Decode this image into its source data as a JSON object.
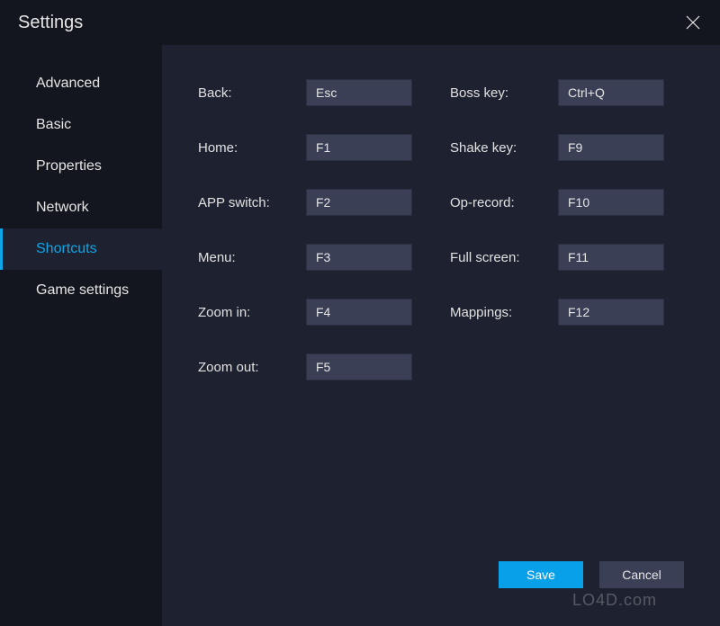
{
  "titlebar": {
    "title": "Settings"
  },
  "sidebar": {
    "items": [
      {
        "label": "Advanced",
        "active": false
      },
      {
        "label": "Basic",
        "active": false
      },
      {
        "label": "Properties",
        "active": false
      },
      {
        "label": "Network",
        "active": false
      },
      {
        "label": "Shortcuts",
        "active": true
      },
      {
        "label": "Game settings",
        "active": false
      }
    ]
  },
  "shortcuts": {
    "left": [
      {
        "label": "Back:",
        "value": "Esc"
      },
      {
        "label": "Home:",
        "value": "F1"
      },
      {
        "label": "APP switch:",
        "value": "F2"
      },
      {
        "label": "Menu:",
        "value": "F3"
      },
      {
        "label": "Zoom in:",
        "value": "F4"
      },
      {
        "label": "Zoom out:",
        "value": "F5"
      }
    ],
    "right": [
      {
        "label": "Boss key:",
        "value": "Ctrl+Q"
      },
      {
        "label": "Shake key:",
        "value": "F9"
      },
      {
        "label": "Op-record:",
        "value": "F10"
      },
      {
        "label": "Full screen:",
        "value": "F11"
      },
      {
        "label": "Mappings:",
        "value": "F12"
      }
    ]
  },
  "footer": {
    "save": "Save",
    "cancel": "Cancel"
  },
  "watermark": "LO4D.com"
}
